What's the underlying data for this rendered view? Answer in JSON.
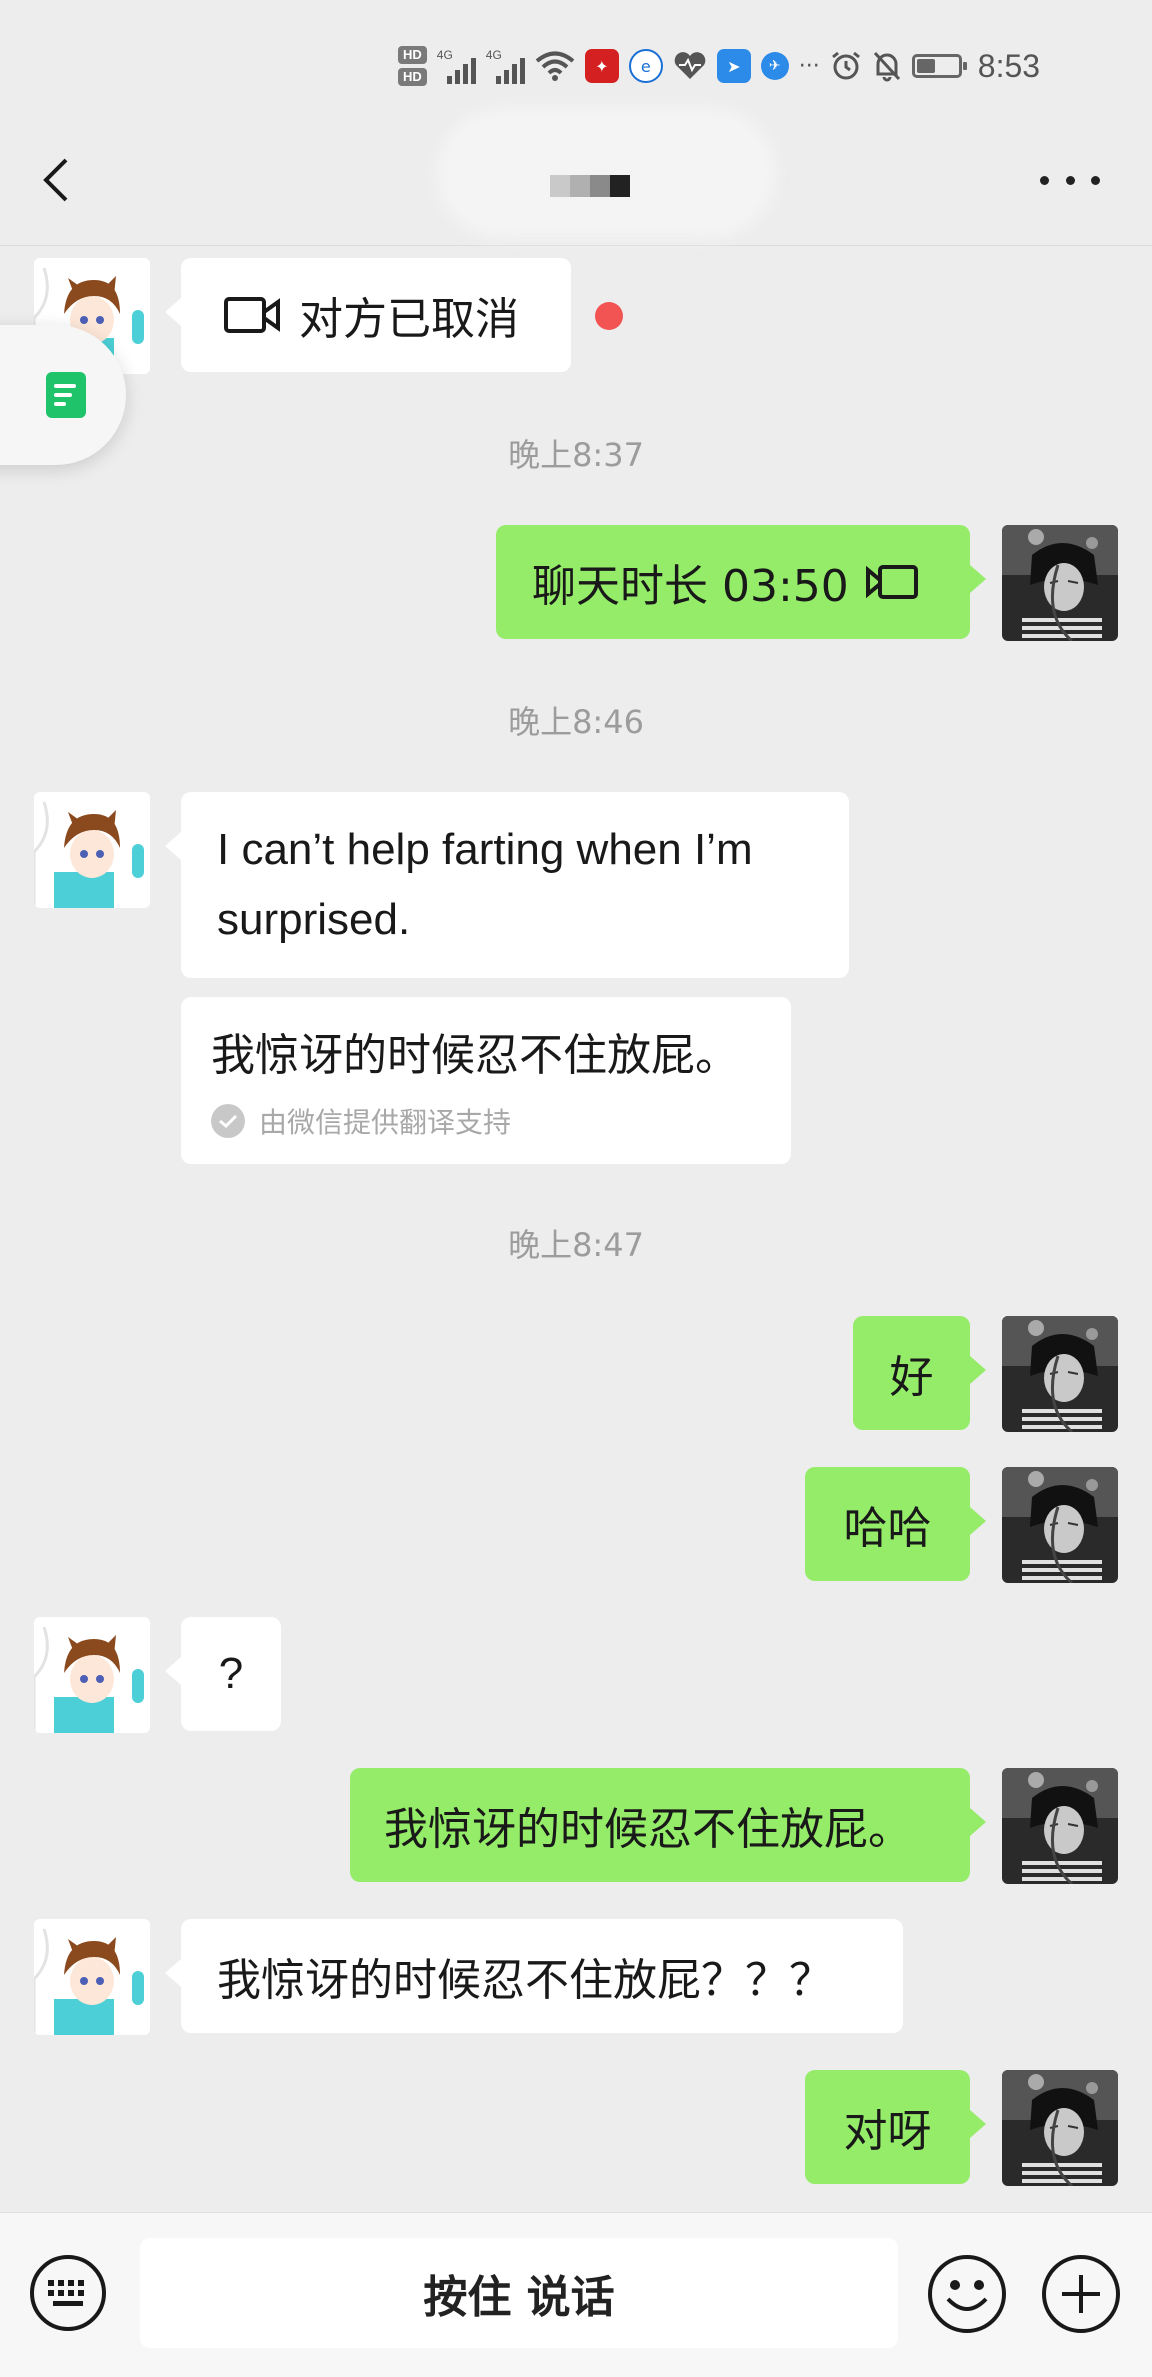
{
  "status_bar": {
    "hd1": "HD",
    "hd2": "HD",
    "network1": "4G",
    "network2": "4G",
    "time": "8:53",
    "battery_level": 0.45,
    "icons": [
      "hd-icon",
      "signal-icon",
      "wifi-icon",
      "app-notification-icon",
      "browser-icon",
      "health-icon",
      "messenger-icon",
      "telegram-icon",
      "more-dots-icon",
      "alarm-icon",
      "mute-icon",
      "battery-icon"
    ]
  },
  "nav": {
    "back_icon": "chevron-left-icon",
    "title_placeholder": "",
    "more_icon": "more-icon"
  },
  "floating_tab": {
    "icon": "document-icon"
  },
  "messages": [
    {
      "type": "call",
      "dir": "in",
      "text": "对方已取消",
      "icon": "video-call-icon",
      "unread": true
    },
    {
      "type": "time",
      "text": "晚上8:37"
    },
    {
      "type": "call",
      "dir": "out",
      "text": "聊天时长 03:50",
      "icon": "video-call-icon"
    },
    {
      "type": "time",
      "text": "晚上8:46"
    },
    {
      "type": "text",
      "dir": "in",
      "text": "I can’t help farting when I’m surprised."
    },
    {
      "type": "translation",
      "text": "我惊讶的时候忍不住放屁。",
      "note": "由微信提供翻译支持"
    },
    {
      "type": "time",
      "text": "晚上8:47"
    },
    {
      "type": "text",
      "dir": "out",
      "text": "好"
    },
    {
      "type": "text",
      "dir": "out",
      "text": "哈哈"
    },
    {
      "type": "text",
      "dir": "in",
      "text": "?"
    },
    {
      "type": "text",
      "dir": "out",
      "text": "我惊讶的时候忍不住放屁。"
    },
    {
      "type": "text",
      "dir": "in",
      "text": "我惊讶的时候忍不住放屁？？？"
    },
    {
      "type": "text",
      "dir": "out",
      "text": "对呀"
    }
  ],
  "input_bar": {
    "keyboard_icon": "keyboard-icon",
    "hold_to_talk": "按住 说话",
    "emoji_icon": "emoji-icon",
    "plus_icon": "plus-icon"
  },
  "colors": {
    "background": "#ededed",
    "outgoing_bubble": "#95ec69",
    "incoming_bubble": "#ffffff",
    "timestamp": "#9c9c9c",
    "unread_dot": "#f25454"
  }
}
